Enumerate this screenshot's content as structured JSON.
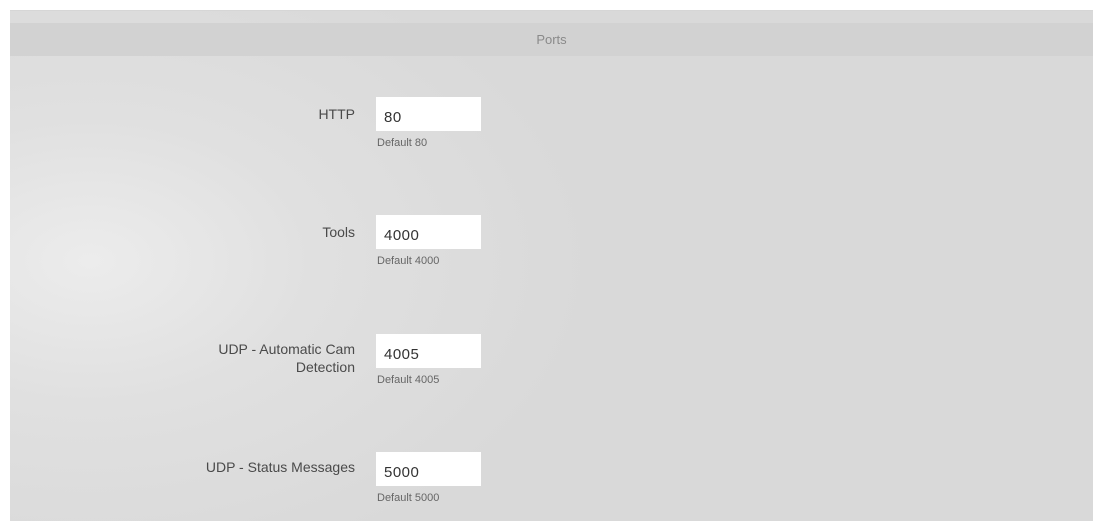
{
  "section": {
    "title": "Ports"
  },
  "fields": [
    {
      "label": "HTTP",
      "value": "80",
      "hint": "Default 80"
    },
    {
      "label": "Tools",
      "value": "4000",
      "hint": "Default 4000"
    },
    {
      "label": "UDP - Automatic Cam Detection",
      "value": "4005",
      "hint": "Default 4005"
    },
    {
      "label": "UDP - Status Messages",
      "value": "5000",
      "hint": "Default 5000"
    }
  ]
}
